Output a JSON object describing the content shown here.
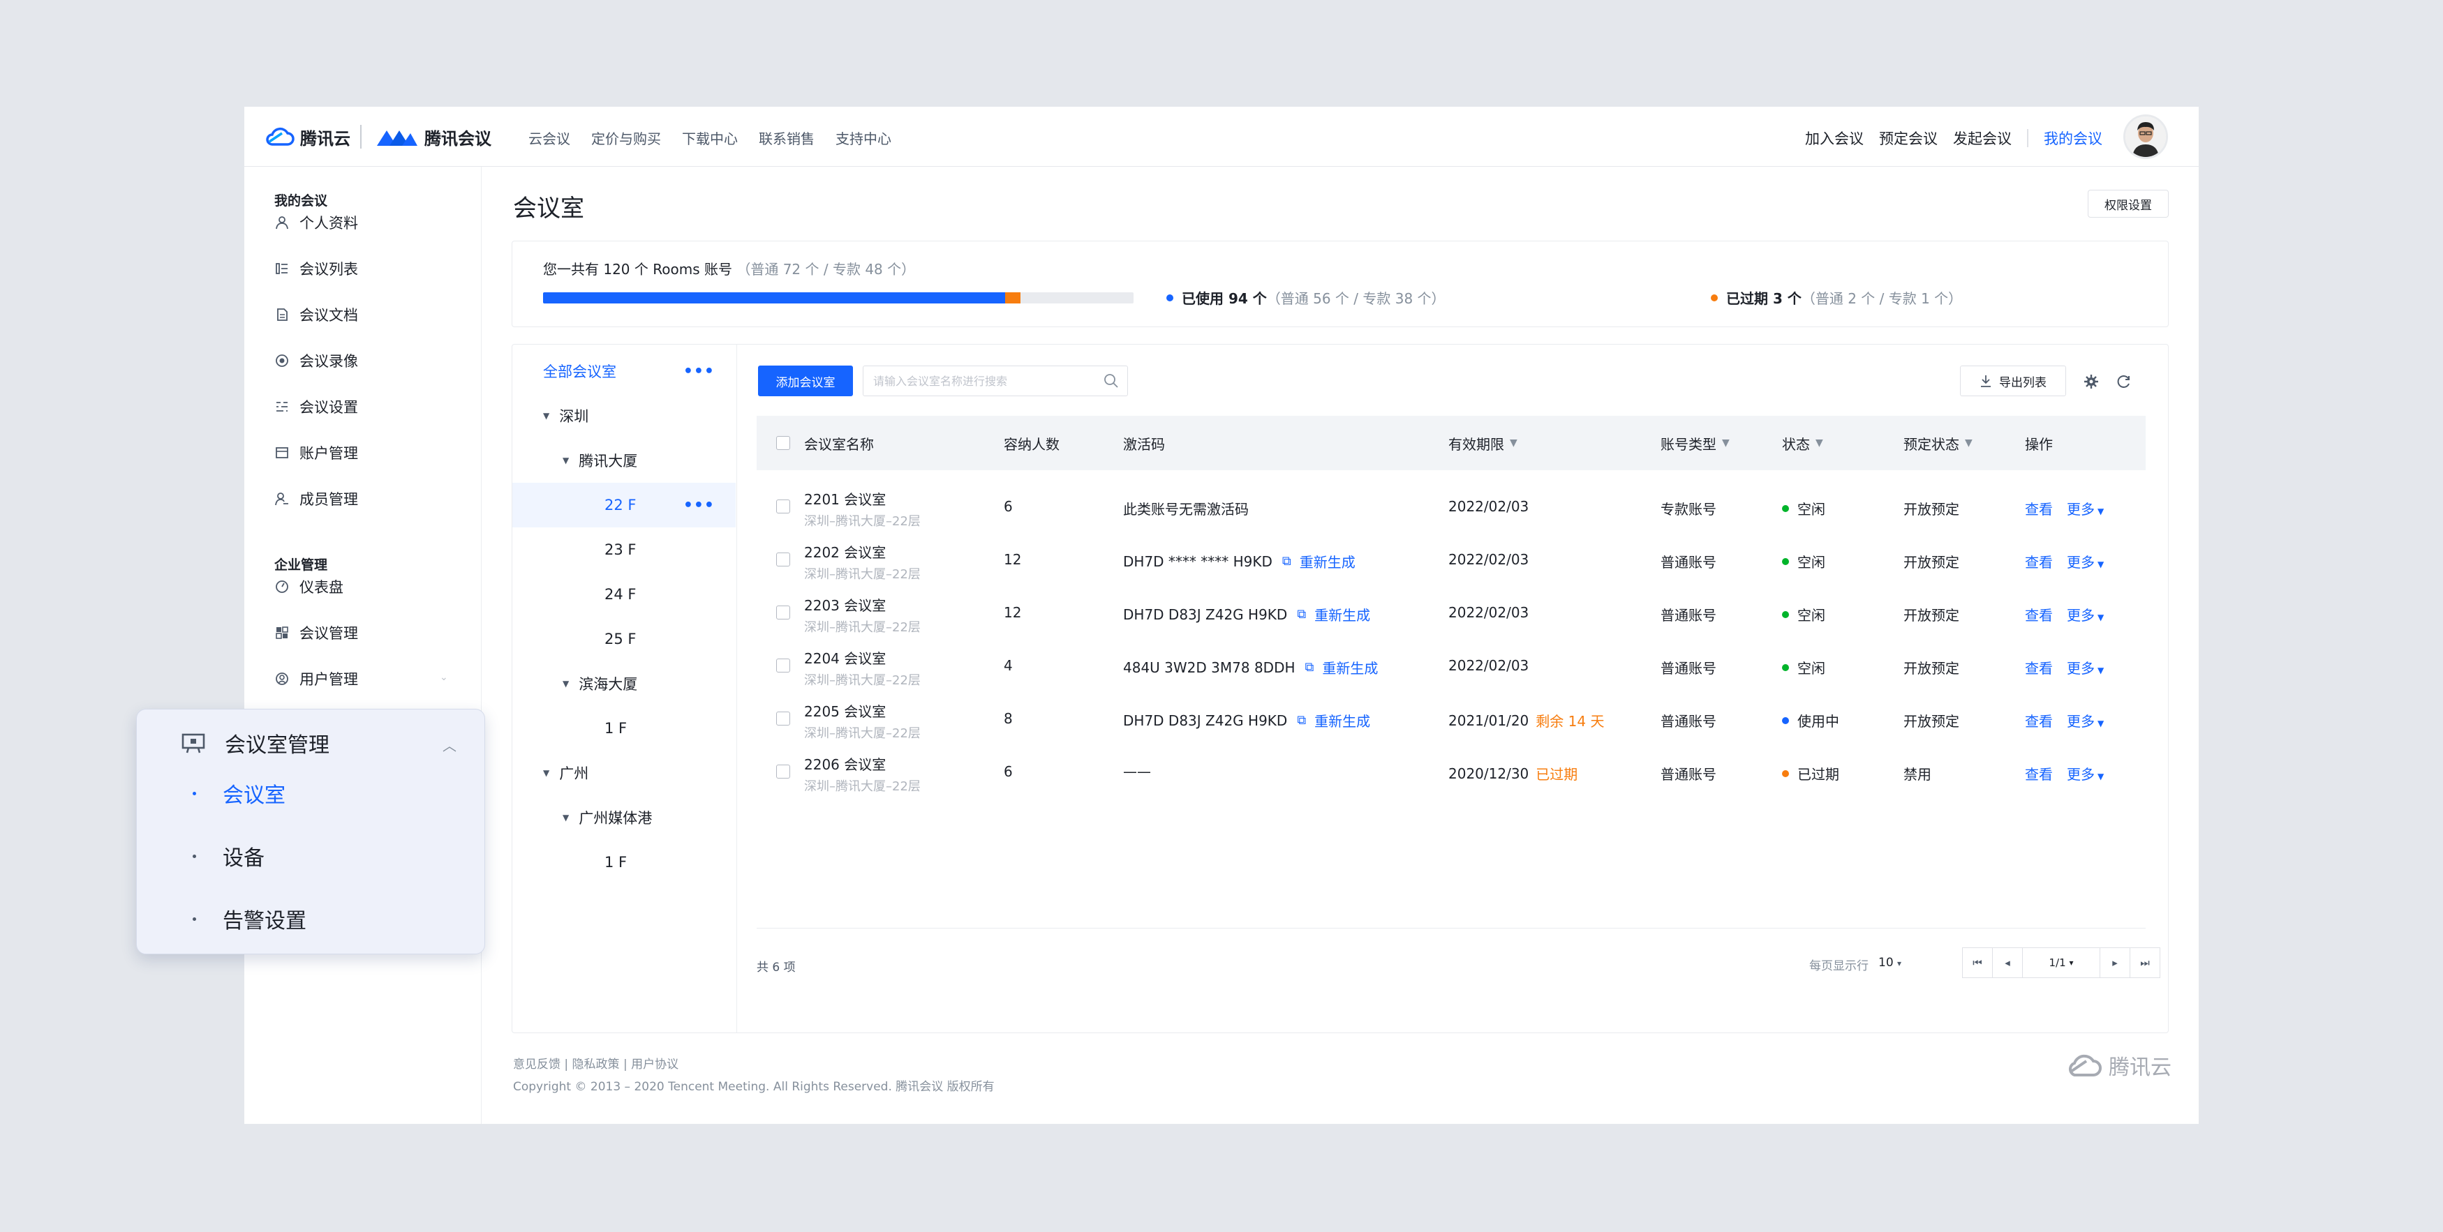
{
  "brand": {
    "cloud_name": "腾讯云",
    "meeting_name": "腾讯会议",
    "footer_logo": "腾讯云"
  },
  "topnav": [
    "云会议",
    "定价与购买",
    "下载中心",
    "联系销售",
    "支持中心"
  ],
  "topright": {
    "join": "加入会议",
    "schedule": "预定会议",
    "start": "发起会议",
    "mine": "我的会议"
  },
  "sidebar": {
    "group1": "我的会议",
    "items1": [
      {
        "label": "个人资料",
        "icon": "user-icon"
      },
      {
        "label": "会议列表",
        "icon": "list-icon"
      },
      {
        "label": "会议文档",
        "icon": "doc-icon"
      },
      {
        "label": "会议录像",
        "icon": "record-icon"
      },
      {
        "label": "会议设置",
        "icon": "settings-icon"
      },
      {
        "label": "账户管理",
        "icon": "account-icon"
      },
      {
        "label": "成员管理",
        "icon": "members-icon"
      }
    ],
    "group2": "企业管理",
    "items2": [
      {
        "label": "仪表盘",
        "icon": "dashboard-icon"
      },
      {
        "label": "会议管理",
        "icon": "grid-icon"
      },
      {
        "label": "用户管理",
        "icon": "user-manage-icon"
      }
    ]
  },
  "popup": {
    "title": "会议室管理",
    "items": [
      "会议室",
      "设备",
      "告警设置"
    ]
  },
  "page": {
    "title": "会议室",
    "perm_button": "权限设置"
  },
  "summary": {
    "line1_main": "您一共有 120 个 Rooms 账号",
    "line1_detail": "（普通 72 个 / 专款 48 个）",
    "used_label": "已使用 94 个",
    "used_detail": "（普通 56 个 / 专款 38 个）",
    "expired_label": "已过期 3 个",
    "expired_detail": "（普通 2 个 / 专款 1 个）",
    "used_fraction": 0.783,
    "expired_fraction": 0.025,
    "colors": {
      "used": "#1664ff",
      "expired": "#f77d0f"
    }
  },
  "tree": [
    {
      "label": "全部会议室",
      "level": 0,
      "selected_text": true,
      "more": "•••"
    },
    {
      "label": "深圳",
      "level": 1,
      "arrow": "▼"
    },
    {
      "label": "腾讯大厦",
      "level": 2,
      "arrow": "▼"
    },
    {
      "label": "22 F",
      "level": 3,
      "selected": true,
      "more": "•••"
    },
    {
      "label": "23 F",
      "level": 3
    },
    {
      "label": "24 F",
      "level": 3
    },
    {
      "label": "25 F",
      "level": 3
    },
    {
      "label": "滨海大厦",
      "level": 2,
      "arrow": "▼"
    },
    {
      "label": "1 F",
      "level": 3
    },
    {
      "label": "广州",
      "level": 1,
      "arrow": "▼"
    },
    {
      "label": "广州媒体港",
      "level": 2,
      "arrow": "▼"
    },
    {
      "label": "1 F",
      "level": 3
    }
  ],
  "toolbar": {
    "add": "添加会议室",
    "search_placeholder": "请输入会议室名称进行搜索",
    "export": "导出列表"
  },
  "table": {
    "headers": [
      "会议室名称",
      "容纳人数",
      "激活码",
      "有效期限",
      "账号类型",
      "状态",
      "预定状态",
      "操作"
    ],
    "rows": [
      {
        "name": "2201 会议室",
        "loc": "深圳–腾讯大厦–22层",
        "cap": "6",
        "code": "此类账号无需激活码",
        "regen": "",
        "date": "2022/02/03",
        "date_note": "",
        "type": "专款账号",
        "status": "空闲",
        "status_color": "#00b42a",
        "book": "开放预定",
        "view": "查看",
        "more": "更多"
      },
      {
        "name": "2202 会议室",
        "loc": "深圳–腾讯大厦–22层",
        "cap": "12",
        "code": "DH7D **** **** H9KD",
        "regen": "重新生成",
        "date": "2022/02/03",
        "date_note": "",
        "type": "普通账号",
        "status": "空闲",
        "status_color": "#00b42a",
        "book": "开放预定",
        "view": "查看",
        "more": "更多"
      },
      {
        "name": "2203 会议室",
        "loc": "深圳–腾讯大厦–22层",
        "cap": "12",
        "code": "DH7D D83J Z42G H9KD",
        "regen": "重新生成",
        "date": "2022/02/03",
        "date_note": "",
        "type": "普通账号",
        "status": "空闲",
        "status_color": "#00b42a",
        "book": "开放预定",
        "view": "查看",
        "more": "更多"
      },
      {
        "name": "2204 会议室",
        "loc": "深圳–腾讯大厦–22层",
        "cap": "4",
        "code": "484U 3W2D 3M78 8DDH",
        "regen": "重新生成",
        "date": "2022/02/03",
        "date_note": "",
        "type": "普通账号",
        "status": "空闲",
        "status_color": "#00b42a",
        "book": "开放预定",
        "view": "查看",
        "more": "更多"
      },
      {
        "name": "2205 会议室",
        "loc": "深圳–腾讯大厦–22层",
        "cap": "8",
        "code": "DH7D D83J Z42G H9KD",
        "regen": "重新生成",
        "date": "2021/01/20",
        "date_note": "剩余 14 天",
        "type": "普通账号",
        "status": "使用中",
        "status_color": "#1664ff",
        "book": "开放预定",
        "view": "查看",
        "more": "更多"
      },
      {
        "name": "2206 会议室",
        "loc": "深圳–腾讯大厦–22层",
        "cap": "6",
        "code": "——",
        "regen": "",
        "date": "2020/12/30",
        "date_note": "已过期",
        "type": "普通账号",
        "status": "已过期",
        "status_color": "#f77d0f",
        "book": "禁用",
        "view": "查看",
        "more": "更多"
      }
    ]
  },
  "pagination": {
    "total": "共 6 项",
    "per_page_label": "每页显示行",
    "per_page": "10",
    "page": "1/1"
  },
  "footer": {
    "links": "意见反馈 | 隐私政策 | 用户协议",
    "copyright": "Copyright © 2013 – 2020 Tencent Meeting. All Rights Reserved.  腾讯会议 版权所有"
  }
}
